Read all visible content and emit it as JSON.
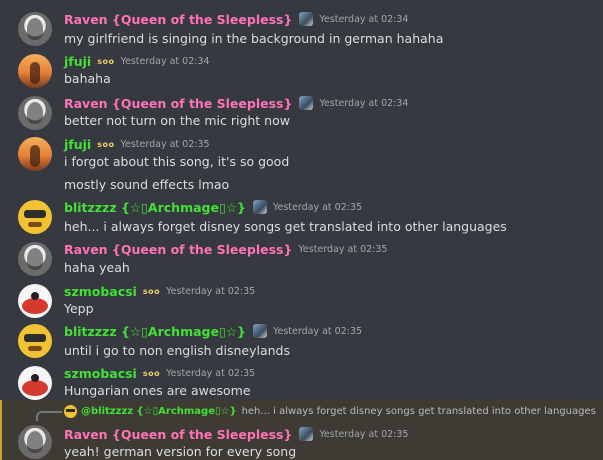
{
  "messages": [
    {
      "author": "Raven {Queen of the Sleepless}",
      "time": "Yesterday at 02:34",
      "lines": [
        "my girlfriend is singing in the background in german hahaha"
      ]
    },
    {
      "author": "jfuji",
      "badge": "soo",
      "time": "Yesterday at 02:34",
      "lines": [
        "bahaha"
      ]
    },
    {
      "author": "Raven {Queen of the Sleepless}",
      "time": "Yesterday at 02:34",
      "lines": [
        "better not turn on the mic right now"
      ]
    },
    {
      "author": "jfuji",
      "badge": "soo",
      "time": "Yesterday at 02:35",
      "lines": [
        "i forgot about this song, it's so good",
        "mostly sound effects lmao"
      ]
    },
    {
      "author": "blitzzzz {☆▯Archmage▯☆}",
      "time": "Yesterday at 02:35",
      "lines": [
        "heh... i always forget disney songs get translated into other languages"
      ]
    },
    {
      "author": "Raven {Queen of the Sleepless}",
      "time": "Yesterday at 02:35",
      "lines": [
        "haha yeah"
      ]
    },
    {
      "author": "szmobacsi",
      "badge": "soo",
      "time": "Yesterday at 02:35",
      "lines": [
        "Yepp"
      ]
    },
    {
      "author": "blitzzzz {☆▯Archmage▯☆}",
      "time": "Yesterday at 02:35",
      "lines": [
        "until i go to non english disneylands"
      ]
    },
    {
      "author": "szmobacsi",
      "badge": "soo",
      "time": "Yesterday at 02:35",
      "lines": [
        "Hungarian ones are awesome"
      ]
    },
    {
      "author": "Raven {Queen of the Sleepless}",
      "time": "Yesterday at 02:35",
      "lines": [
        "yeah! german version for every song"
      ],
      "reply": {
        "author": "@blitzzzz {☆▯Archmage▯☆}",
        "text": "heh... i always forget disney songs get translated into other languages"
      }
    }
  ],
  "colors": {
    "raven": "#ff73b6",
    "green": "#43e036",
    "background": "#36393f",
    "highlight": "#3d3b33"
  }
}
